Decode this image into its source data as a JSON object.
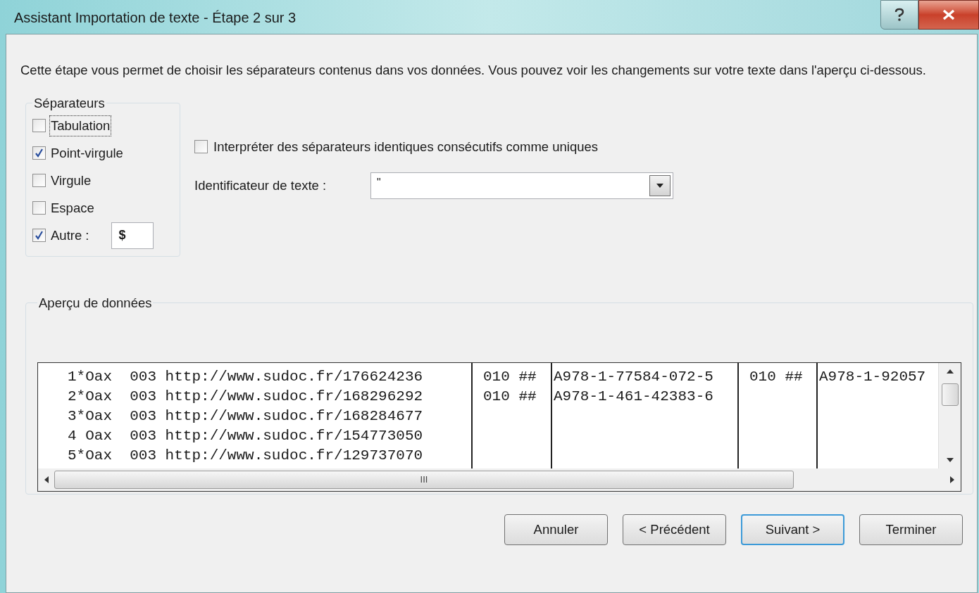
{
  "window": {
    "title": "Assistant Importation de texte - Étape 2 sur 3"
  },
  "description": "Cette étape vous permet de choisir les séparateurs contenus dans vos données. Vous pouvez voir les changements sur votre texte dans l'aperçu ci-dessous.",
  "separators": {
    "legend": "Séparateurs",
    "options": [
      {
        "kind": "plain",
        "label": "Tabulation",
        "checked": false,
        "focused": true
      },
      {
        "kind": "plain",
        "label": "Point-virgule",
        "checked": true,
        "focused": false
      },
      {
        "kind": "plain",
        "label": "Virgule",
        "checked": false,
        "focused": false
      },
      {
        "kind": "plain",
        "label": "Espace",
        "checked": false,
        "focused": false
      },
      {
        "kind": "other",
        "label": "Autre :",
        "checked": true,
        "focused": false,
        "value": "$"
      }
    ]
  },
  "consecutive": {
    "label": "Interpréter des séparateurs identiques consécutifs comme uniques",
    "checked": false
  },
  "text_qualifier": {
    "label": "Identificateur de texte :",
    "value": "\""
  },
  "preview": {
    "legend": "Aperçu de données",
    "scroll_grip": "III",
    "columns": [
      {
        "cells": [
          "1*Oax  003 http://www.sudoc.fr/176624236",
          "2*Oax  003 http://www.sudoc.fr/168296292",
          "3*Oax  003 http://www.sudoc.fr/168284677",
          "4 Oax  003 http://www.sudoc.fr/154773050",
          "5*Oax  003 http://www.sudoc.fr/129737070"
        ]
      },
      {
        "cells": [
          "010 ##",
          "010 ##"
        ]
      },
      {
        "cells": [
          "A978-1-77584-072-5",
          "A978-1-461-42383-6"
        ]
      },
      {
        "cells": [
          "010 ##"
        ]
      },
      {
        "cells": [
          "A978-1-92057"
        ]
      }
    ]
  },
  "buttons": [
    {
      "label": "Annuler",
      "default": false
    },
    {
      "label": "< Précédent",
      "default": false
    },
    {
      "label": "Suivant >",
      "default": true
    },
    {
      "label": "Terminer",
      "default": false
    }
  ]
}
